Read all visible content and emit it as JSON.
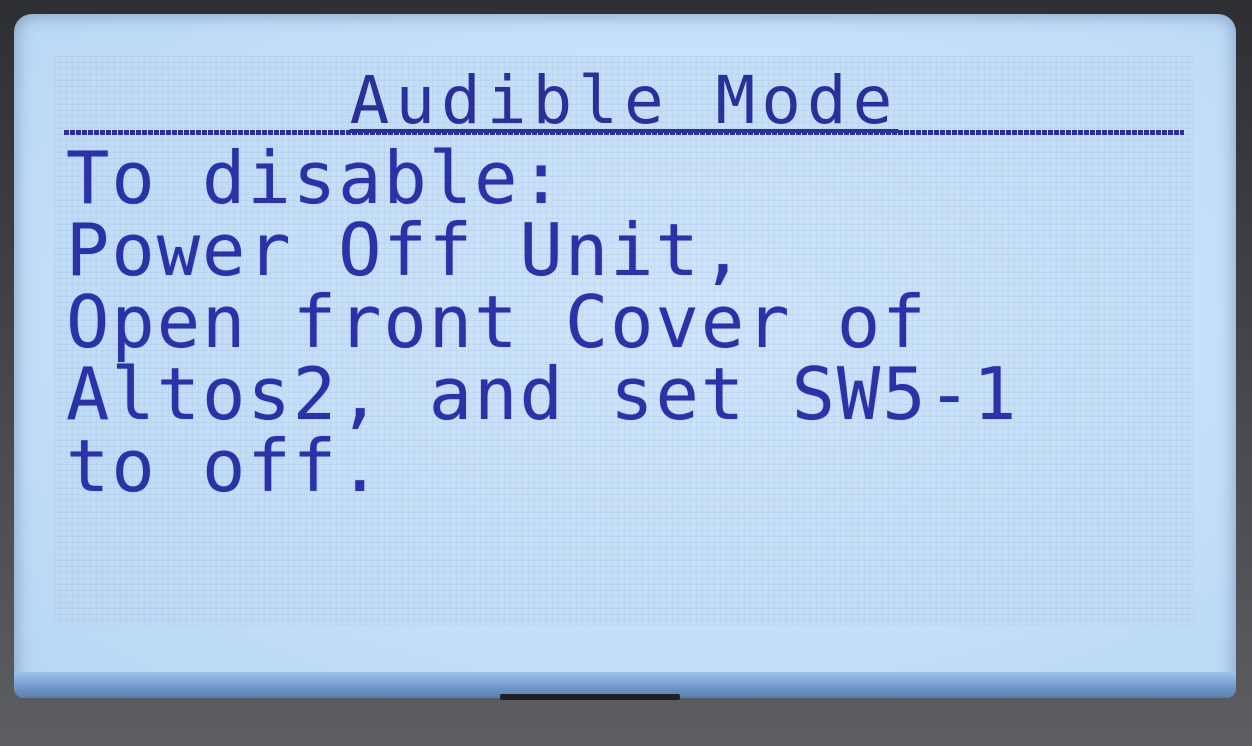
{
  "display": {
    "title": "Audible Mode",
    "lines": [
      "To disable:",
      "Power Off Unit,",
      "Open front Cover of",
      "Altos2, and set SW5-1",
      "to off."
    ]
  },
  "colors": {
    "screen_bg": "#c9e3fb",
    "text": "#2b31a6",
    "bezel": "#3a3b3e"
  }
}
